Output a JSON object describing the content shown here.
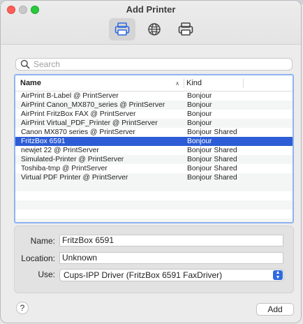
{
  "window": {
    "title": "Add Printer"
  },
  "toolbar": [
    {
      "name": "default-tab",
      "icon": "printer-icon",
      "selected": true
    },
    {
      "name": "ip-tab",
      "icon": "globe-icon",
      "selected": false
    },
    {
      "name": "windows-tab",
      "icon": "printer-icon",
      "selected": false
    }
  ],
  "search": {
    "placeholder": "Search",
    "value": ""
  },
  "table": {
    "columns": {
      "name": "Name",
      "kind": "Kind"
    },
    "sort_icon": "chevron-up-icon",
    "rows": [
      {
        "name": "AirPrint B-Label @ PrintServer",
        "kind": "Bonjour",
        "selected": false
      },
      {
        "name": "AirPrint Canon_MX870_series @ PrintServer",
        "kind": "Bonjour",
        "selected": false
      },
      {
        "name": "AirPrint FritzBox FAX @ PrintServer",
        "kind": "Bonjour",
        "selected": false
      },
      {
        "name": "AirPrint Virtual_PDF_Printer @ PrintServer",
        "kind": "Bonjour",
        "selected": false
      },
      {
        "name": "Canon MX870 series @ PrintServer",
        "kind": "Bonjour Shared",
        "selected": false
      },
      {
        "name": "FritzBox 6591",
        "kind": "Bonjour",
        "selected": true
      },
      {
        "name": "newjet 22 @ PrintServer",
        "kind": "Bonjour Shared",
        "selected": false
      },
      {
        "name": "Simulated-Printer @ PrintServer",
        "kind": "Bonjour Shared",
        "selected": false
      },
      {
        "name": "Toshiba-tmp @ PrintServer",
        "kind": "Bonjour Shared",
        "selected": false
      },
      {
        "name": "Virtual PDF Printer @ PrintServer",
        "kind": "Bonjour Shared",
        "selected": false
      }
    ]
  },
  "details": {
    "name_label": "Name:",
    "name_value": "FritzBox 6591",
    "location_label": "Location:",
    "location_value": "Unknown",
    "use_label": "Use:",
    "use_value": "Cups-IPP Driver (FritzBox 6591 FaxDriver)"
  },
  "buttons": {
    "help": "?",
    "add": "Add"
  },
  "colors": {
    "selection": "#2e5cd6",
    "focus_ring": "#8fb3f1",
    "close": "#ff5f57",
    "zoom": "#28c840"
  }
}
